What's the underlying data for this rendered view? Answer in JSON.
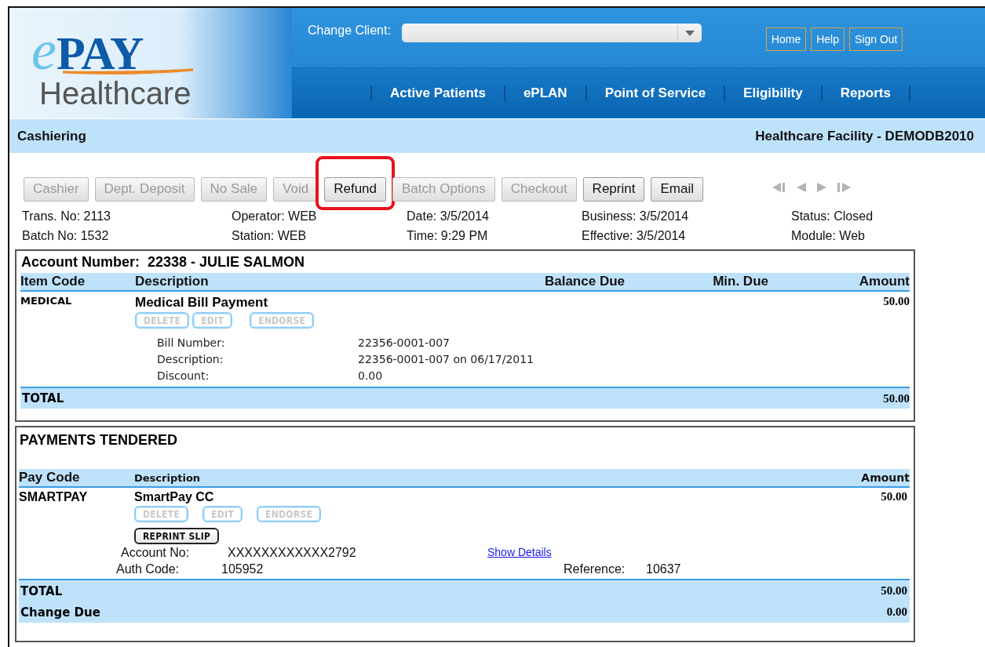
{
  "header": {
    "logo": {
      "prefix": "e",
      "brand": "PAY",
      "tagline": "Healthcare"
    },
    "change_client": {
      "label": "Change Client:"
    },
    "top_links": [
      "Home",
      "Help",
      "Sign Out"
    ],
    "nav": [
      "Active Patients",
      "ePLAN",
      "Point of Service",
      "Eligibility",
      "Reports"
    ]
  },
  "subheader": {
    "title": "Cashiering",
    "facility": "Healthcare Facility - DEMODB2010"
  },
  "toolbar": [
    {
      "label": "Cashier",
      "disabled": true,
      "highlighted": false
    },
    {
      "label": "Dept. Deposit",
      "disabled": true,
      "highlighted": false
    },
    {
      "label": "No Sale",
      "disabled": true,
      "highlighted": false
    },
    {
      "label": "Void",
      "disabled": true,
      "highlighted": false
    },
    {
      "label": "Refund",
      "disabled": false,
      "highlighted": true
    },
    {
      "label": "Batch Options",
      "disabled": true,
      "highlighted": false
    },
    {
      "label": "Checkout",
      "disabled": true,
      "highlighted": false
    },
    {
      "label": "Reprint",
      "disabled": false,
      "highlighted": false
    },
    {
      "label": "Email",
      "disabled": false,
      "highlighted": false
    }
  ],
  "info": [
    [
      "Trans. No: 2113",
      "Batch No: 1532"
    ],
    [
      "Operator: WEB",
      "Station: WEB"
    ],
    [
      "Date: 3/5/2014",
      "Time: 9:29 PM"
    ],
    [
      "Business: 3/5/2014",
      "Effective: 3/5/2014"
    ],
    [
      "Status: Closed",
      "Module: Web"
    ]
  ],
  "account": {
    "title": "Account Number:  22338 - JULIE SALMON",
    "columns": [
      "Item Code",
      "Description",
      "Balance Due",
      "Min. Due",
      "Amount"
    ],
    "items": [
      {
        "code": "MEDICAL",
        "description": "Medical Bill Payment",
        "amount": "50.00",
        "actions": [
          {
            "label": "DELETE",
            "disabled": true
          },
          {
            "label": "EDIT",
            "disabled": true
          },
          {
            "label": "ENDORSE",
            "disabled": true
          }
        ],
        "details": [
          {
            "label": "Bill Number:",
            "value": "22356-0001-007"
          },
          {
            "label": "Description:",
            "value": "22356-0001-007 on 06/17/2011"
          },
          {
            "label": "Discount:",
            "value": "0.00"
          }
        ]
      }
    ],
    "total": {
      "label": "TOTAL",
      "amount": "50.00"
    }
  },
  "payments": {
    "title": "PAYMENTS TENDERED",
    "columns": [
      "Pay Code",
      "Description",
      "Amount"
    ],
    "items": [
      {
        "code": "SMARTPAY",
        "description": "SmartPay CC",
        "amount": "50.00",
        "actions": [
          {
            "label": "DELETE",
            "disabled": true
          },
          {
            "label": "EDIT",
            "disabled": true
          },
          {
            "label": "ENDORSE",
            "disabled": true
          }
        ],
        "reprint": {
          "label": "REPRINT SLIP",
          "disabled": false
        },
        "account_no": {
          "label": "Account No:",
          "value": "XXXXXXXXXXXX2792"
        },
        "show_details": "Show Details",
        "auth_code": {
          "label": "Auth Code:",
          "value": "105952"
        },
        "reference": {
          "label": "Reference:",
          "value": "10637"
        }
      }
    ],
    "totals": [
      {
        "label": "TOTAL",
        "amount": "50.00"
      },
      {
        "label": "Change Due",
        "amount": "0.00"
      }
    ]
  }
}
